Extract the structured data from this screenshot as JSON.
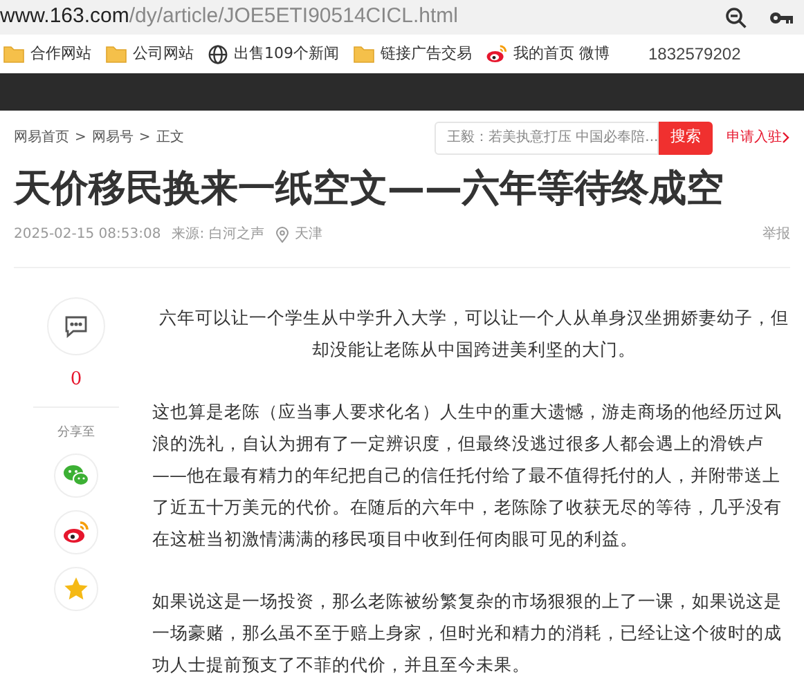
{
  "address_bar": {
    "url_host": "www.163.com",
    "url_path": "/dy/article/JOE5ETI90514CICL.html"
  },
  "bookmarks": [
    {
      "kind": "folder",
      "label": "合作网站"
    },
    {
      "kind": "folder",
      "label": "公司网站"
    },
    {
      "kind": "globe",
      "label": "出售109个新闻"
    },
    {
      "kind": "folder",
      "label": "链接广告交易"
    },
    {
      "kind": "weibo",
      "label": "我的首页 微博"
    }
  ],
  "bookmark_extra": "1832579202",
  "breadcrumb": [
    "网易首页",
    "网易号",
    "正文"
  ],
  "breadcrumb_separator": ">",
  "search": {
    "placeholder": "王毅：若美执意打压 中国必奉陪...",
    "button": "搜索"
  },
  "join_link": "申请入驻",
  "article": {
    "title": "天价移民换来一纸空文——六年等待终成空",
    "date": "2025-02-15 08:53:08",
    "source": "来源: 白河之声",
    "location": "天津",
    "report": "举报",
    "paragraphs": [
      {
        "kind": "centered",
        "text": "六年可以让一个学生从中学升入大学，可以让一个人从单身汉坐拥娇妻幼子，但却没能让老陈从中国跨进美利坚的大门。"
      },
      {
        "kind": "normal",
        "text": "这也算是老陈（应当事人要求化名）人生中的重大遗憾，游走商场的他经历过风浪的洗礼，自认为拥有了一定辨识度，但最终没逃过很多人都会遇上的滑铁卢——他在最有精力的年纪把自己的信任托付给了最不值得托付的人，并附带送上了近五十万美元的代价。在随后的六年中，老陈除了收获无尽的等待，几乎没有在这桩当初激情满满的移民项目中收到任何肉眼可见的利益。"
      },
      {
        "kind": "normal",
        "text": "如果说这是一场投资，那么老陈被纷繁复杂的市场狠狠的上了一课，如果说这是一场豪赌，那么虽不至于赔上身家，但时光和精力的消耗，已经让这个彼时的成功人士提前预支了不菲的代价，并且至今未果。"
      }
    ]
  },
  "sidebar": {
    "comment_count": "0",
    "share_label": "分享至",
    "share_buttons": [
      {
        "kind": "wechat"
      },
      {
        "kind": "weibo"
      },
      {
        "kind": "favorite"
      }
    ]
  }
}
